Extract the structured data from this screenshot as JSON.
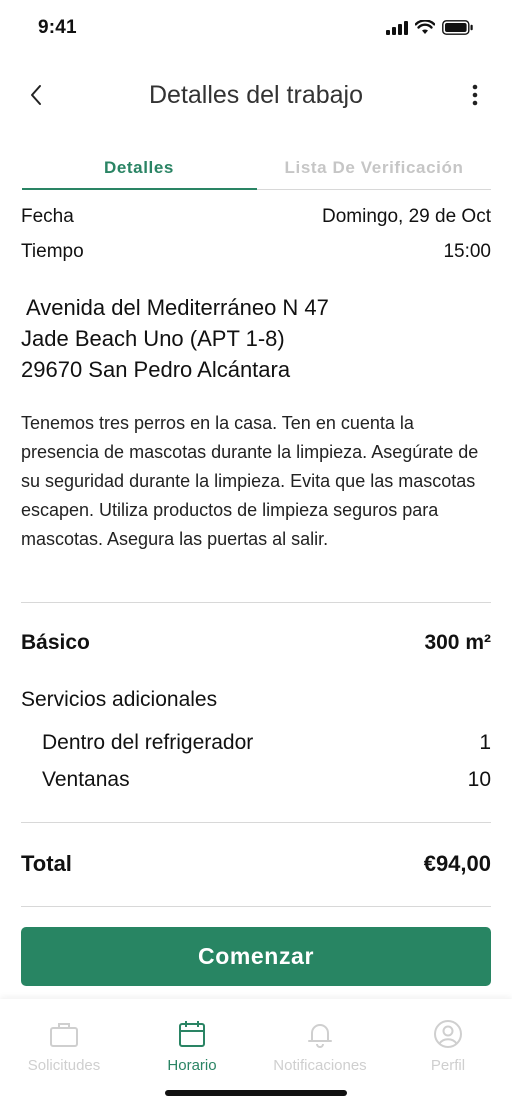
{
  "status_bar": {
    "time": "9:41"
  },
  "header": {
    "title": "Detalles del trabajo",
    "back_icon": "chevron-left-icon",
    "more_icon": "vertical-dots-icon"
  },
  "tabs": [
    {
      "label": "Detalles",
      "active": true
    },
    {
      "label": "Lista De Verificación",
      "active": false
    }
  ],
  "details": {
    "fecha_label": "Fecha",
    "fecha_value": "Domingo, 29 de Oct",
    "tiempo_label": "Tiempo",
    "tiempo_value": "15:00"
  },
  "address": {
    "line1": "Avenida del Mediterráneo N 47",
    "line2": "Jade Beach Uno (APT 1-8)",
    "line3": "29670 San Pedro Alcántara"
  },
  "description": "Tenemos tres perros en la casa. Ten en cuenta la presencia de mascotas durante la limpieza. Asegúrate de su seguridad durante la limpieza. Evita que las mascotas escapen. Utiliza productos de limpieza seguros para mascotas. Asegura las puertas al salir.",
  "service": {
    "basico_label": "Básico",
    "basico_value": "300 m²",
    "extras_label": "Servicios adicionales",
    "extras": [
      {
        "label": "Dentro del refrigerador",
        "value": "1"
      },
      {
        "label": "Ventanas",
        "value": "10"
      }
    ],
    "total_label": "Total",
    "total_value": "€94,00"
  },
  "start_button": "Comenzar",
  "tabbar": [
    {
      "label": "Solicitudes",
      "icon": "briefcase-icon",
      "active": false
    },
    {
      "label": "Horario",
      "icon": "calendar-icon",
      "active": true
    },
    {
      "label": "Notificaciones",
      "icon": "bell-icon",
      "active": false
    },
    {
      "label": "Perfil",
      "icon": "user-icon",
      "active": false
    }
  ],
  "colors": {
    "accent": "#2a8464",
    "button": "#288563",
    "inactive": "#cfcfcf"
  }
}
